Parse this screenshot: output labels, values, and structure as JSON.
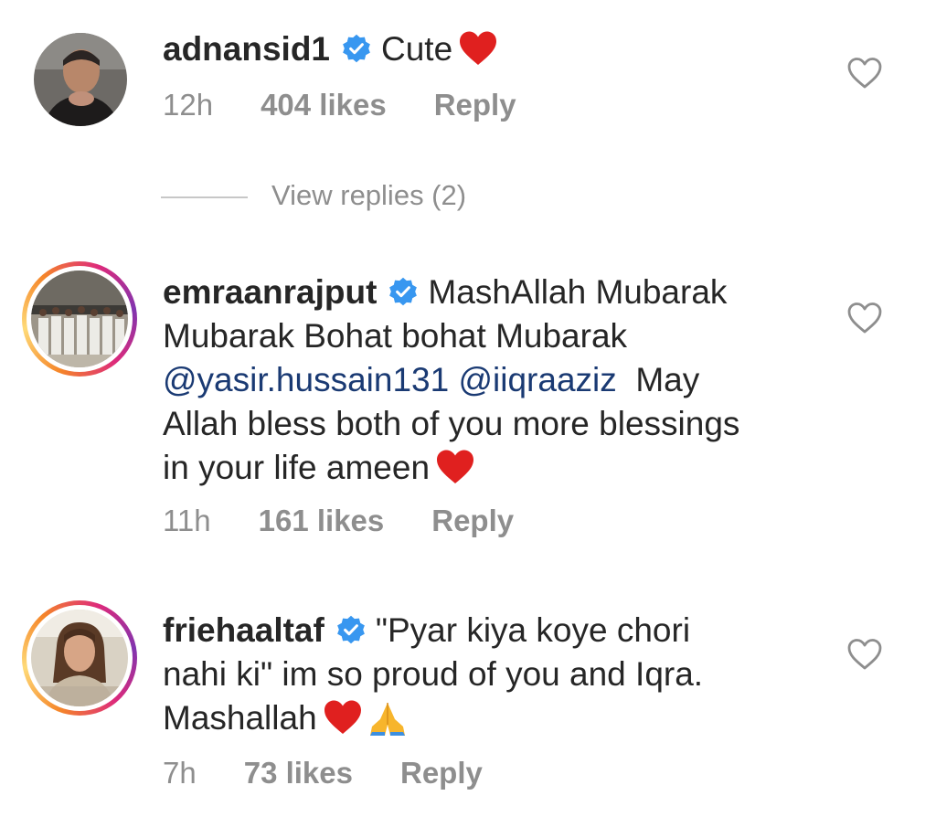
{
  "comments": [
    {
      "username": "adnansid1",
      "text_parts": [
        "Cute"
      ],
      "time": "12h",
      "likes": "404 likes",
      "reply": "Reply",
      "emoji": [
        "heart"
      ]
    },
    {
      "username": "emraanrajput",
      "line1": "MashAllah Mubarak",
      "line2": "Mubarak Bohat bohat Mubarak",
      "mention1": "@yasir.hussain131",
      "mention2": "@iiqraaziz",
      "line3_tail": "May",
      "line4": "Allah bless both of you more blessings",
      "line5": "in your life ameen",
      "time": "11h",
      "likes": "161 likes",
      "reply": "Reply",
      "emoji": [
        "heart"
      ]
    },
    {
      "username": "friehaaltaf",
      "line1": "\"Pyar kiya koye chori",
      "line2": "nahi ki\" im so proud of you and Iqra.",
      "line3": "Mashallah",
      "time": "7h",
      "likes": "73 likes",
      "reply": "Reply",
      "emoji": [
        "heart",
        "folded-hands"
      ]
    }
  ],
  "view_replies": "View replies (2)",
  "colors": {
    "text": "#262626",
    "meta": "#8e8e8e",
    "verified": "#3897f0",
    "mention": "#1a3a73",
    "heart": "#e0201f"
  },
  "icons": [
    "verified-badge-icon",
    "heart-outline-icon",
    "heart-emoji-icon",
    "folded-hands-emoji-icon"
  ]
}
